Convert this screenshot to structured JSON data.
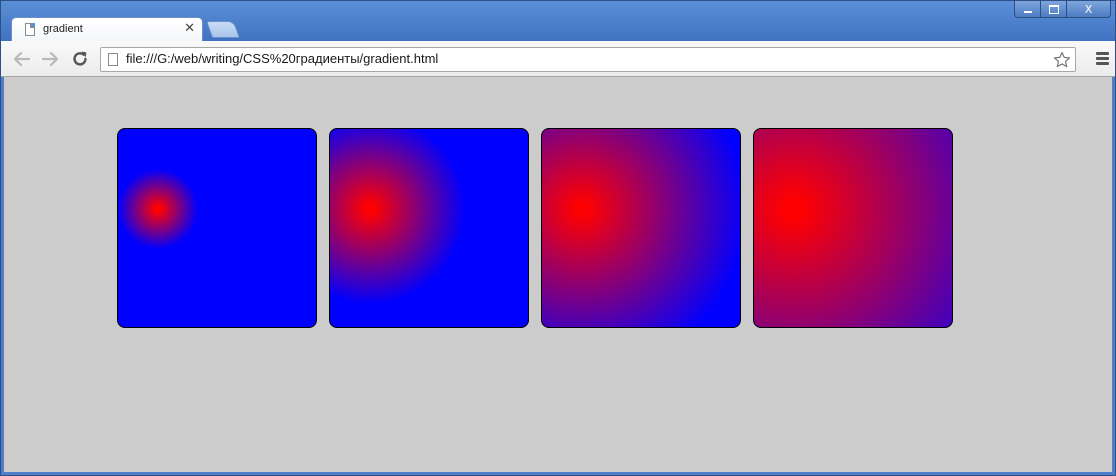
{
  "tab": {
    "title": "gradient",
    "close_glyph": "✕"
  },
  "window_controls": {
    "close_glyph": "X"
  },
  "toolbar": {
    "url": "file:///G:/web/writing/CSS%20градиенты/gradient.html"
  },
  "icons": {
    "tab": "document-icon",
    "back": "back-arrow-icon",
    "forward": "forward-arrow-icon",
    "reload": "reload-icon",
    "page": "document-icon",
    "bookmark": "star-icon",
    "menu": "hamburger-menu-icon"
  },
  "colors": {
    "page_background": "#cccccc",
    "gradient_center": "#ff0000",
    "gradient_outer": "#0000ff",
    "frame": "#4e7fc9"
  },
  "gradient_boxes": [
    {
      "name": "gradient-box-1"
    },
    {
      "name": "gradient-box-2"
    },
    {
      "name": "gradient-box-3"
    },
    {
      "name": "gradient-box-4"
    }
  ]
}
